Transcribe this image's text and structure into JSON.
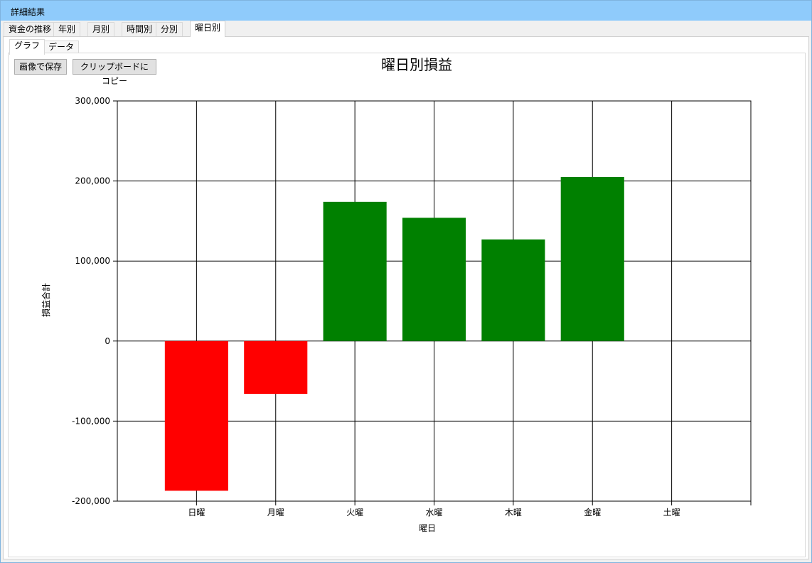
{
  "window": {
    "title": "詳細結果"
  },
  "tabs": [
    {
      "label": "資金の推移"
    },
    {
      "label": "年別"
    },
    {
      "label": "月別"
    },
    {
      "label": "時間別"
    },
    {
      "label": "分別"
    },
    {
      "label": "曜日別"
    }
  ],
  "active_tab": "曜日別",
  "subtabs": [
    {
      "label": "グラフ"
    },
    {
      "label": "データ"
    }
  ],
  "active_subtab": "グラフ",
  "toolbar": {
    "save_image_label": "画像で保存",
    "copy_clipboard_label": "クリップボードにコピー"
  },
  "colors": {
    "positive": "#008000",
    "negative": "#ff0000",
    "titlebar": "#8fcbfb"
  },
  "chart_data": {
    "type": "bar",
    "title": "曜日別損益",
    "xlabel": "曜日",
    "ylabel": "損益合計",
    "categories": [
      "日曜",
      "月曜",
      "火曜",
      "水曜",
      "木曜",
      "金曜",
      "土曜"
    ],
    "values": [
      -187000,
      -66000,
      174000,
      154000,
      127000,
      205000,
      0
    ],
    "ylim": [
      -200000,
      300000
    ],
    "yticks": [
      300000,
      200000,
      100000,
      0,
      -100000,
      -200000
    ],
    "ytick_labels": [
      "300,000",
      "200,000",
      "100,000",
      "0",
      "-100,000",
      "-200,000"
    ],
    "grid": true,
    "legend": "none"
  }
}
